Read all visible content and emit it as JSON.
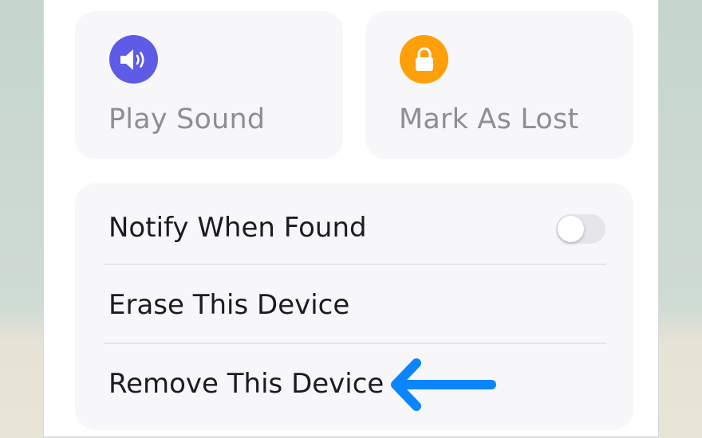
{
  "actions": {
    "play_sound": {
      "label": "Play Sound",
      "icon": "speaker-icon",
      "color": "#5e5ce6"
    },
    "mark_as_lost": {
      "label": "Mark As Lost",
      "icon": "lock-icon",
      "color": "#ff9f0a"
    }
  },
  "options": {
    "notify": {
      "label": "Notify When Found",
      "toggle_on": false
    },
    "erase": {
      "label": "Erase This Device"
    },
    "remove": {
      "label": "Remove This Device"
    }
  },
  "annotation": {
    "icon": "arrow-left-icon",
    "color": "#0a84ff"
  }
}
